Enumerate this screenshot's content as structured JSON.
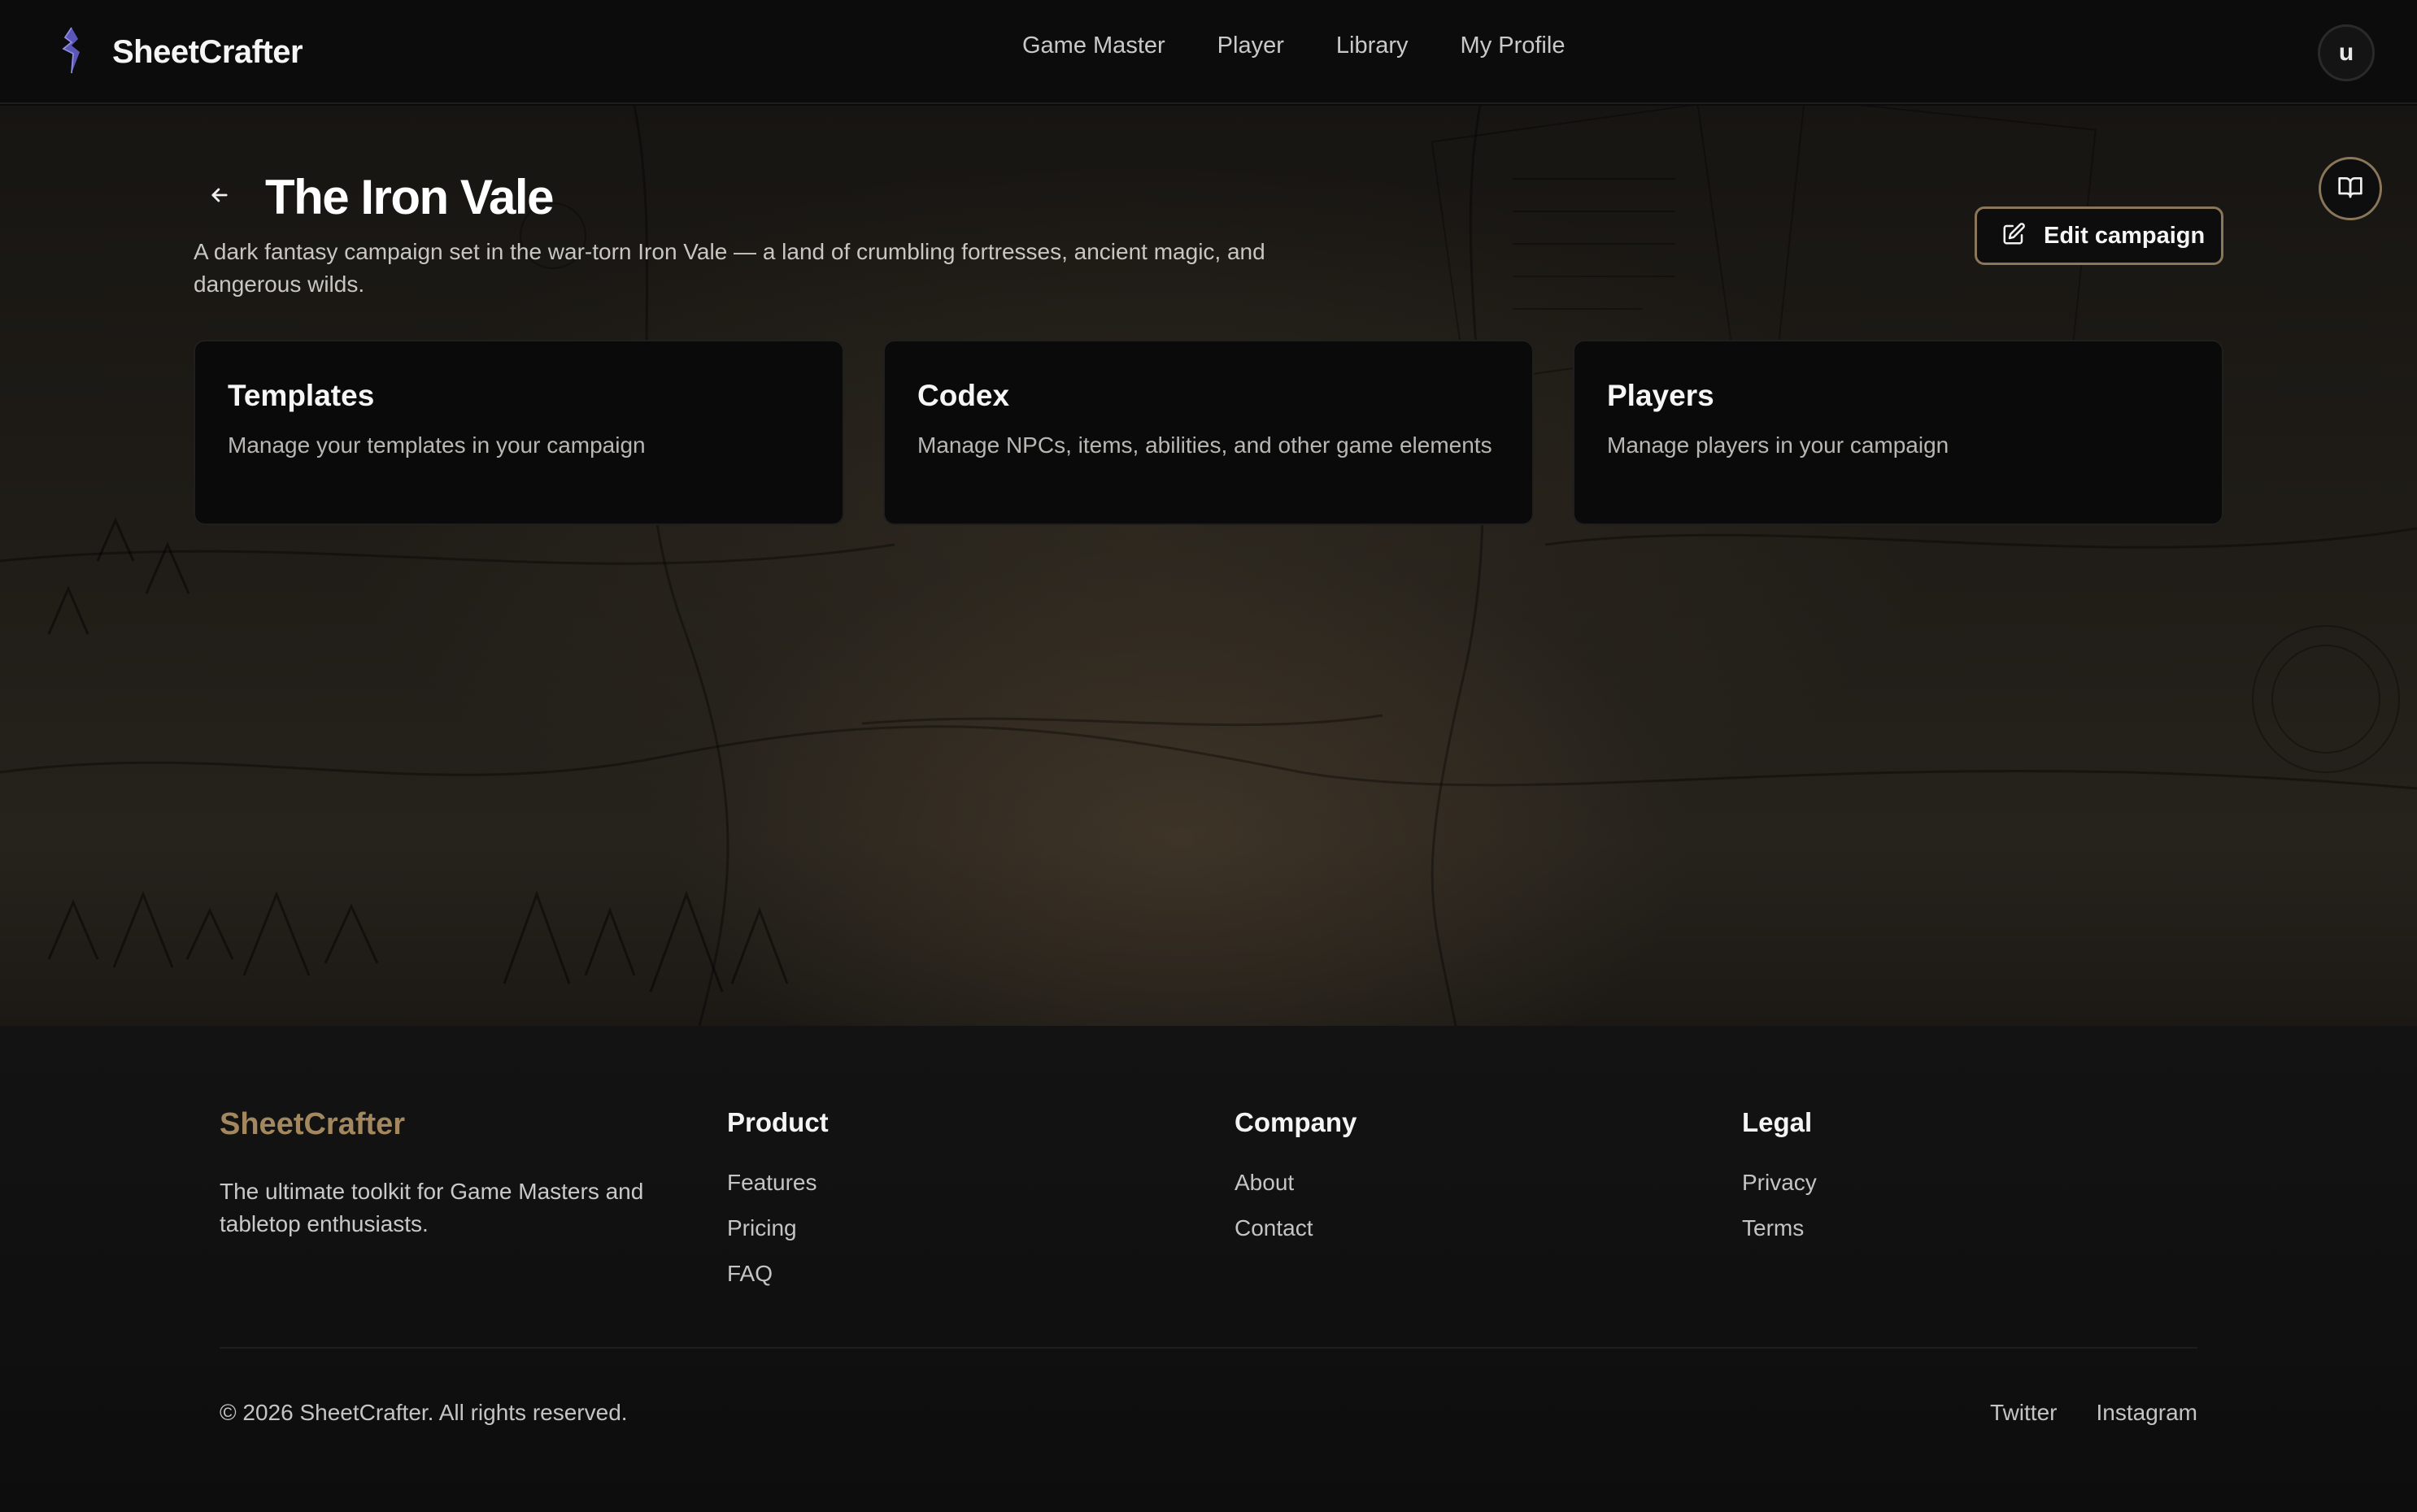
{
  "header": {
    "brand": "SheetCrafter",
    "nav": [
      "Game Master",
      "Player",
      "Library",
      "My Profile"
    ],
    "avatar_initial": "u"
  },
  "campaign": {
    "title": "The Iron Vale",
    "description": "A dark fantasy campaign set in the war-torn Iron Vale — a land of crumbling fortresses, ancient magic, and dangerous wilds.",
    "edit_label": "Edit campaign"
  },
  "cards": [
    {
      "title": "Templates",
      "description": "Manage your templates in your campaign"
    },
    {
      "title": "Codex",
      "description": "Manage NPCs, items, abilities, and other game elements"
    },
    {
      "title": "Players",
      "description": "Manage players in your campaign"
    }
  ],
  "footer": {
    "brand": "SheetCrafter",
    "tagline": "The ultimate toolkit for Game Masters and tabletop enthusiasts.",
    "columns": [
      {
        "heading": "Product",
        "links": [
          "Features",
          "Pricing",
          "FAQ"
        ]
      },
      {
        "heading": "Company",
        "links": [
          "About",
          "Contact"
        ]
      },
      {
        "heading": "Legal",
        "links": [
          "Privacy",
          "Terms"
        ]
      }
    ],
    "copyright": "© 2026 SheetCrafter. All rights reserved.",
    "social": [
      "Twitter",
      "Instagram"
    ]
  },
  "colors": {
    "accent": "#a3875e",
    "accent_border": "#8a7658",
    "background": "#0b0b0b"
  },
  "icons": [
    "brand-logo-icon",
    "arrow-left-icon",
    "edit-icon",
    "book-open-icon"
  ]
}
